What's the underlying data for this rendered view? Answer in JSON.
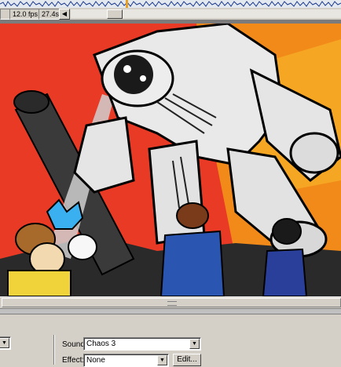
{
  "timeline": {
    "frame_rate": "12.0 fps",
    "elapsed": "27.4s",
    "nav_left_glyph": "◀"
  },
  "properties": {
    "sound_label": "Sound:",
    "sound_value": "Chaos 3",
    "effect_label": "Effect:",
    "effect_value": "None",
    "edit_label": "Edit...",
    "dropdown_glyph": "▼"
  },
  "colors": {
    "panel": "#d4d0c8",
    "stage_backdrop": "#7b7b7b",
    "waveform": "#1a3a8f"
  }
}
